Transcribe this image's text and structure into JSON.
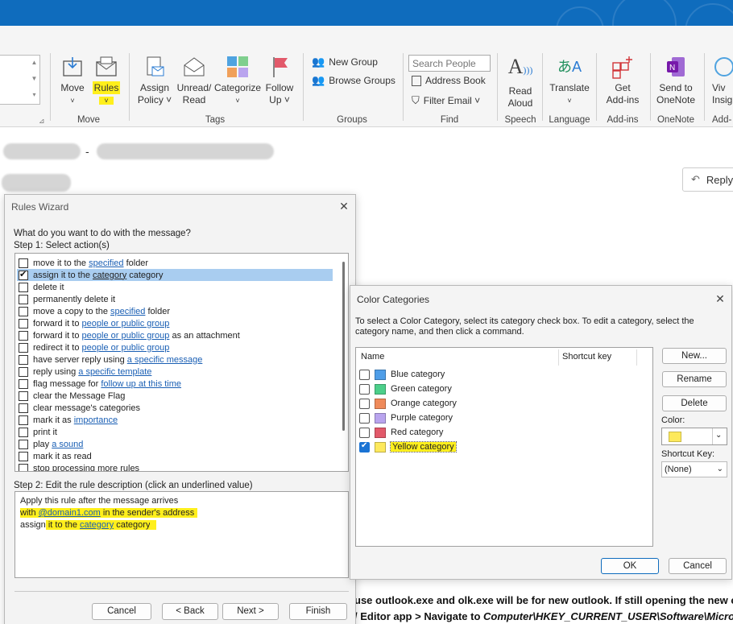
{
  "ribbon": {
    "move": "Move",
    "rules": "Rules",
    "assign_policy": [
      "Assign",
      "Policy ˅"
    ],
    "unread_read": [
      "Unread/",
      "Read"
    ],
    "categorize": "Categorize",
    "follow_up": [
      "Follow",
      "Up ˅"
    ],
    "new_group": "New Group",
    "browse_groups": "Browse Groups",
    "search_people_placeholder": "Search People",
    "address_book": "Address Book",
    "filter_email": "Filter Email ˅",
    "read_aloud": [
      "Read",
      "Aloud"
    ],
    "translate": "Translate",
    "get_addins": [
      "Get",
      "Add-ins"
    ],
    "send_onenote": [
      "Send to",
      "OneNote"
    ],
    "viva": [
      "Viv",
      "Insig"
    ],
    "groups": [
      "Move",
      "Tags",
      "Groups",
      "Find",
      "Speech",
      "Language",
      "Add-ins",
      "OneNote",
      "Add-"
    ]
  },
  "email": {
    "separator": "-",
    "reply": "Reply"
  },
  "rules_wizard": {
    "title": "Rules Wizard",
    "question": "What do you want to do with the message?",
    "step1": "Step 1: Select action(s)",
    "actions": [
      {
        "pre": "move it to the ",
        "link": "specified",
        "post": " folder",
        "checked": false
      },
      {
        "pre": "assign it to the ",
        "link": "category",
        "post": " category",
        "checked": true
      },
      {
        "pre": "delete it",
        "link": "",
        "post": "",
        "checked": false
      },
      {
        "pre": "permanently delete it",
        "link": "",
        "post": "",
        "checked": false
      },
      {
        "pre": "move a copy to the ",
        "link": "specified",
        "post": " folder",
        "checked": false
      },
      {
        "pre": "forward it to ",
        "link": "people or public group",
        "post": "",
        "checked": false
      },
      {
        "pre": "forward it to ",
        "link": "people or public group",
        "post": " as an attachment",
        "checked": false
      },
      {
        "pre": "redirect it to ",
        "link": "people or public group",
        "post": "",
        "checked": false
      },
      {
        "pre": "have server reply using ",
        "link": "a specific message",
        "post": "",
        "checked": false
      },
      {
        "pre": "reply using ",
        "link": "a specific template",
        "post": "",
        "checked": false
      },
      {
        "pre": "flag message for ",
        "link": "follow up at this time",
        "post": "",
        "checked": false
      },
      {
        "pre": "clear the Message Flag",
        "link": "",
        "post": "",
        "checked": false
      },
      {
        "pre": "clear message's categories",
        "link": "",
        "post": "",
        "checked": false
      },
      {
        "pre": "mark it as ",
        "link": "importance",
        "post": "",
        "checked": false
      },
      {
        "pre": "print it",
        "link": "",
        "post": "",
        "checked": false
      },
      {
        "pre": "play ",
        "link": "a sound",
        "post": "",
        "checked": false
      },
      {
        "pre": "mark it as read",
        "link": "",
        "post": "",
        "checked": false
      },
      {
        "pre": "stop processing more rules",
        "link": "",
        "post": "",
        "checked": false
      }
    ],
    "step2": "Step 2: Edit the rule description (click an underlined value)",
    "desc_line1": "Apply this rule after the message arrives",
    "desc_line2_pre": "with ",
    "desc_line2_link": "@domain1.com",
    "desc_line2_post": " in the sender's address",
    "desc_line3_pre": "assign",
    "desc_line3_mid": " it to the ",
    "desc_line3_link": "category",
    "desc_line3_post": " category",
    "buttons": {
      "cancel": "Cancel",
      "back": "< Back",
      "next": "Next >",
      "finish": "Finish"
    }
  },
  "color_categories": {
    "title": "Color Categories",
    "instructions": "To select a Color Category, select its category check box.  To edit a category, select the category name, and then click a command.",
    "col_name": "Name",
    "col_shortcut": "Shortcut key",
    "categories": [
      {
        "name": "Blue category",
        "color": "#4f9ee8",
        "checked": false
      },
      {
        "name": "Green category",
        "color": "#4ccf8a",
        "checked": false
      },
      {
        "name": "Orange category",
        "color": "#ef8a5a",
        "checked": false
      },
      {
        "name": "Purple category",
        "color": "#b9a4ee",
        "checked": false
      },
      {
        "name": "Red category",
        "color": "#e2596a",
        "checked": false
      },
      {
        "name": "Yellow category",
        "color": "#fde95c",
        "checked": true
      }
    ],
    "buttons": {
      "new": "New...",
      "rename": "Rename",
      "delete": "Delete",
      "ok": "OK",
      "cancel": "Cancel"
    },
    "color_label": "Color:",
    "shortcut_label": "Shortcut Key:",
    "shortcut_value": "(None)"
  },
  "background_text": {
    "line1": "use outlook.exe and olk.exe will be for new outlook. If still opening the new c",
    "line2_pre": "/ Editor app > Navigate to ",
    "line2_path": "Computer\\HKEY_CURRENT_USER\\Software\\Micros"
  },
  "colors": {
    "accent": "#0f6cbd",
    "highlight": "#ffef1c"
  }
}
